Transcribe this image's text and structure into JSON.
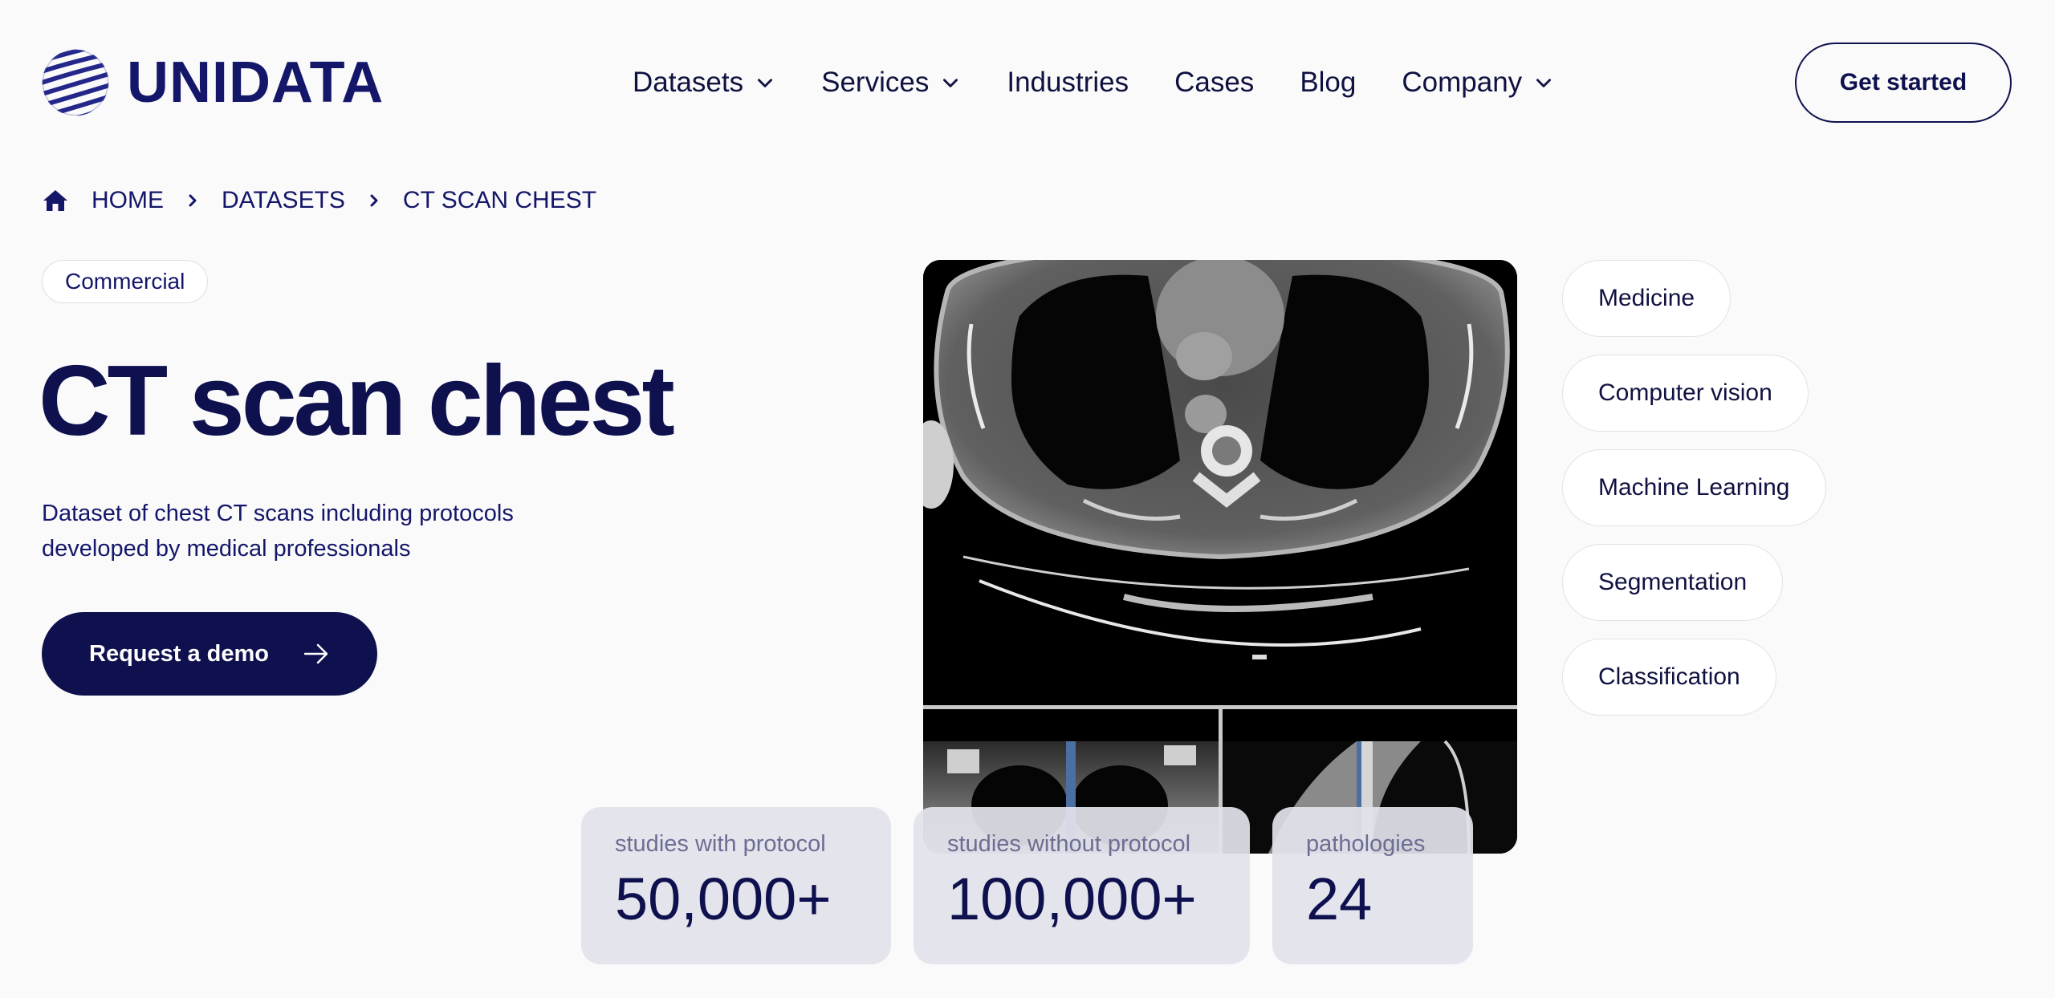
{
  "header": {
    "logo_text": "UNIDATA",
    "nav": [
      {
        "label": "Datasets",
        "has_dropdown": true
      },
      {
        "label": "Services",
        "has_dropdown": true
      },
      {
        "label": "Industries",
        "has_dropdown": false
      },
      {
        "label": "Cases",
        "has_dropdown": false
      },
      {
        "label": "Blog",
        "has_dropdown": false
      },
      {
        "label": "Company",
        "has_dropdown": true
      }
    ],
    "cta_label": "Get started"
  },
  "breadcrumb": {
    "items": [
      "HOME",
      "DATASETS",
      "CT SCAN CHEST"
    ]
  },
  "hero": {
    "badge": "Commercial",
    "title": "CT scan chest",
    "description_line1": "Dataset of chest CT scans including protocols",
    "description_line2": "developed by medical professionals",
    "cta_label": "Request a demo"
  },
  "categories": [
    "Medicine",
    "Computer vision",
    "Machine Learning",
    "Segmentation",
    "Classification"
  ],
  "stats": [
    {
      "label": "studies with protocol",
      "value": "50,000+"
    },
    {
      "label": "studies without protocol",
      "value": "100,000+"
    },
    {
      "label": "pathologies",
      "value": "24"
    }
  ],
  "colors": {
    "brand": "#0f114f",
    "background": "#fafafa",
    "stat_card": "#e2e2ec",
    "muted_text": "#6c6d92"
  },
  "icons": {
    "logo": "striped-globe-icon",
    "dropdown": "chevron-down-icon",
    "home": "home-icon",
    "separator": "chevron-right-icon",
    "cta": "arrow-right-icon"
  }
}
